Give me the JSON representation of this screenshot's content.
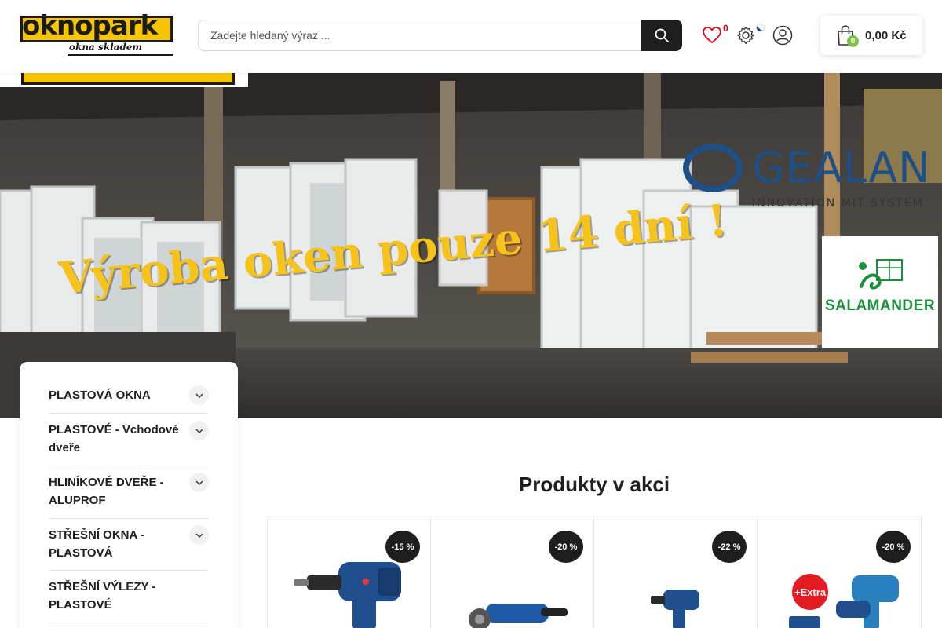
{
  "header": {
    "logo_text": "oknopark",
    "logo_subtitle": "okna skladem",
    "search_placeholder": "Zadejte hledaný výraz ...",
    "wishlist_count": "0",
    "cart_count": "0",
    "cart_total": "0,00 Kč",
    "colors": {
      "brand_yellow": "#f7c600",
      "dark": "#1e1e1e",
      "wishlist_badge": "#e0001b",
      "cart_badge": "#7bc043"
    }
  },
  "hero": {
    "slogan": "Výroba oken pouze 14 dní !",
    "gealan_brand": "GEALAN",
    "gealan_tagline": "INNOVATION MIT SYSTEM",
    "salamander_brand": "SALAMANDER"
  },
  "sidebar": {
    "items": [
      {
        "label": "PLASTOVÁ OKNA",
        "has_submenu": true
      },
      {
        "label": "PLASTOVÉ - Vchodové dveře",
        "has_submenu": true
      },
      {
        "label": "HLINÍKOVÉ DVEŘE - ALUPROF",
        "has_submenu": true
      },
      {
        "label": "STŘEŠNÍ OKNA - PLASTOVÁ",
        "has_submenu": true
      },
      {
        "label": "STŘEŠNÍ VÝLEZY - PLASTOVÉ",
        "has_submenu": false
      }
    ]
  },
  "products_section": {
    "title": "Produkty v akci",
    "items": [
      {
        "discount": "-15 %",
        "image_icon": "drill-icon"
      },
      {
        "discount": "-20 %",
        "image_icon": "angle-grinder-icon"
      },
      {
        "discount": "-22 %",
        "image_icon": "drill-icon"
      },
      {
        "discount": "-20 %",
        "image_icon": "tool-set-icon",
        "extra_label": "+Extra"
      }
    ]
  }
}
